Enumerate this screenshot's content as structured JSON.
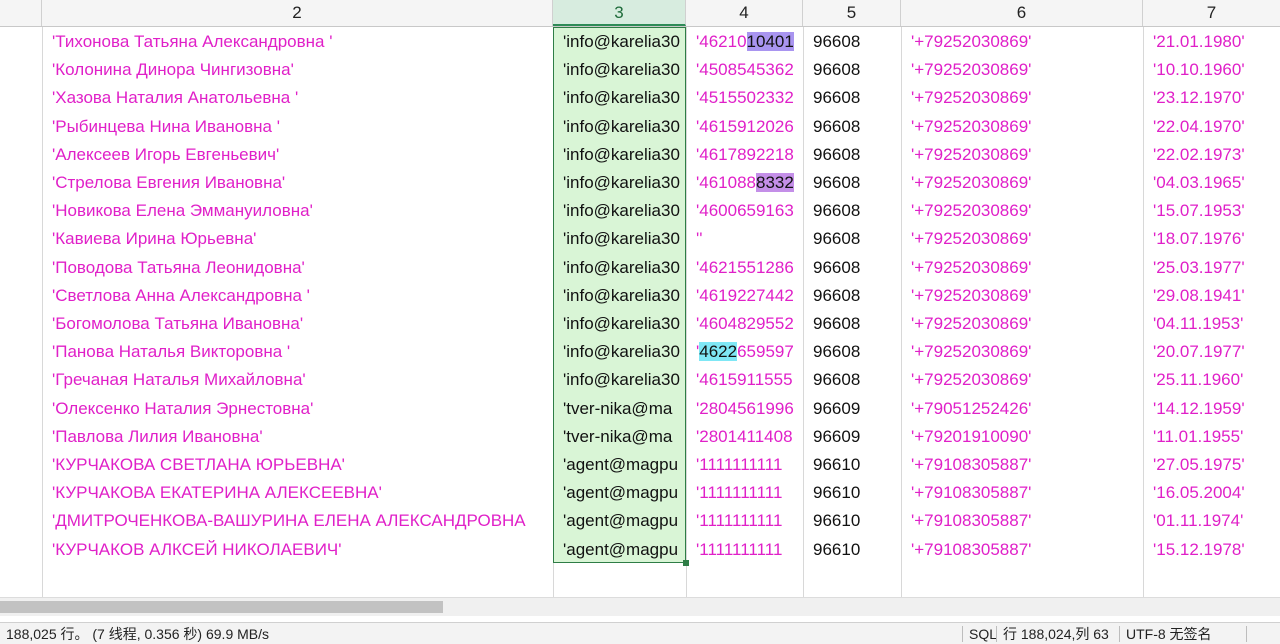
{
  "columns": [
    {
      "label": ""
    },
    {
      "label": "2"
    },
    {
      "label": "3"
    },
    {
      "label": "4"
    },
    {
      "label": "5"
    },
    {
      "label": "6"
    },
    {
      "label": "7"
    }
  ],
  "rows": [
    {
      "name": "'Тихонова Татьяна Александровна '",
      "email": "'info@karelia30",
      "doc": "'46210",
      "doc_hl": "10401",
      "doc_hl_style": "violet",
      "code": "96608",
      "phone": "'+79252030869'",
      "date": "'21.01.1980'"
    },
    {
      "name": "'Колонина Динора Чингизовна'",
      "email": "'info@karelia30",
      "doc": "'4508545362",
      "code": "96608",
      "phone": "'+79252030869'",
      "date": "'10.10.1960'"
    },
    {
      "name": "'Хазова Наталия Анатольевна '",
      "email": "'info@karelia30",
      "doc": "'4515502332",
      "code": "96608",
      "phone": "'+79252030869'",
      "date": "'23.12.1970'"
    },
    {
      "name": "'Рыбинцева Нина Ивановна '",
      "email": "'info@karelia30",
      "doc": "'4615912026",
      "code": "96608",
      "phone": "'+79252030869'",
      "date": "'22.04.1970'"
    },
    {
      "name": "'Алексеев Игорь Евгеньевич'",
      "email": "'info@karelia30",
      "doc": "'4617892218",
      "code": "96608",
      "phone": "'+79252030869'",
      "date": "'22.02.1973'"
    },
    {
      "name": "'Стрелова Евгения Ивановна'",
      "email": "'info@karelia30",
      "doc": "'461088",
      "doc_hl": "8332",
      "doc_hl_style": "purple",
      "code": "96608",
      "phone": "'+79252030869'",
      "date": "'04.03.1965'"
    },
    {
      "name": "'Новикова Елена Эммануиловна'",
      "email": "'info@karelia30",
      "doc": "'4600659163",
      "code": "96608",
      "phone": "'+79252030869'",
      "date": "'15.07.1953'"
    },
    {
      "name": "'Кавиева Ирина Юрьевна'",
      "email": "'info@karelia30",
      "doc": "''",
      "code": "96608",
      "phone": "'+79252030869'",
      "date": "'18.07.1976'"
    },
    {
      "name": "'Поводова Татьяна Леонидовна'",
      "email": "'info@karelia30",
      "doc": "'4621551286",
      "code": "96608",
      "phone": "'+79252030869'",
      "date": "'25.03.1977'"
    },
    {
      "name": "'Светлова Анна Александровна '",
      "email": "'info@karelia30",
      "doc": "'4619227442",
      "code": "96608",
      "phone": "'+79252030869'",
      "date": "'29.08.1941'"
    },
    {
      "name": "'Богомолова Татьяна Ивановна'",
      "email": "'info@karelia30",
      "doc": "'4604829552",
      "code": "96608",
      "phone": "'+79252030869'",
      "date": "'04.11.1953'"
    },
    {
      "name": "'Панова Наталья Викторовна '",
      "email": "'info@karelia30",
      "doc": "'",
      "doc_hl": "4622",
      "doc_tail": "659597",
      "doc_hl_style": "cyan",
      "code": "96608",
      "phone": "'+79252030869'",
      "date": "'20.07.1977'"
    },
    {
      "name": "'Гречаная Наталья Михайловна'",
      "email": "'info@karelia30",
      "doc": "'4615911555",
      "code": "96608",
      "phone": "'+79252030869'",
      "date": "'25.11.1960'"
    },
    {
      "name": "'Олексенко Наталия Эрнестовна'",
      "email": "'tver-nika@ma",
      "doc": "'2804561996",
      "code": "96609",
      "phone": "'+79051252426'",
      "date": "'14.12.1959'"
    },
    {
      "name": "'Павлова Лилия Ивановна'",
      "email": "'tver-nika@ma",
      "doc": "'2801411408",
      "code": "96609",
      "phone": "'+79201910090'",
      "date": "'11.01.1955'"
    },
    {
      "name": "'КУРЧАКОВА СВЕТЛАНА ЮРЬЕВНА'",
      "email": "'agent@magpu",
      "doc": "'1111111111",
      "code": "96610",
      "phone": "'+79108305887'",
      "date": "'27.05.1975'"
    },
    {
      "name": "'КУРЧАКОВА ЕКАТЕРИНА АЛЕКСЕЕВНА'",
      "email": "'agent@magpu",
      "doc": "'1111111111",
      "code": "96610",
      "phone": "'+79108305887'",
      "date": "'16.05.2004'"
    },
    {
      "name": "'ДМИТРОЧЕНКОВА-ВАШУРИНА ЕЛЕНА АЛЕКСАНДРОВНА",
      "email": "'agent@magpu",
      "doc": "'1111111111",
      "code": "96610",
      "phone": "'+79108305887'",
      "date": "'01.11.1974'"
    },
    {
      "name": "'КУРЧАКОВ АЛКСЕЙ НИКОЛАЕВИЧ'",
      "email": "'agent@magpu",
      "doc": "'1111111111",
      "code": "96610",
      "phone": "'+79108305887'",
      "date": "'15.12.1978'"
    }
  ],
  "status": {
    "summary": "188,025 行。 (7 线程, 0.356 秒) 69.9 MB/s",
    "mode": "SQL",
    "position": "行 188,024,列 63",
    "encoding": "UTF-8 无签名"
  },
  "colors": {
    "text_magenta": "#e020c8",
    "selection_fill": "#d9f5d6",
    "selection_border": "#2e7d46",
    "highlight_violet": "#a995f0",
    "highlight_purple": "#c48fe8",
    "highlight_cyan": "#7fe7f5"
  }
}
